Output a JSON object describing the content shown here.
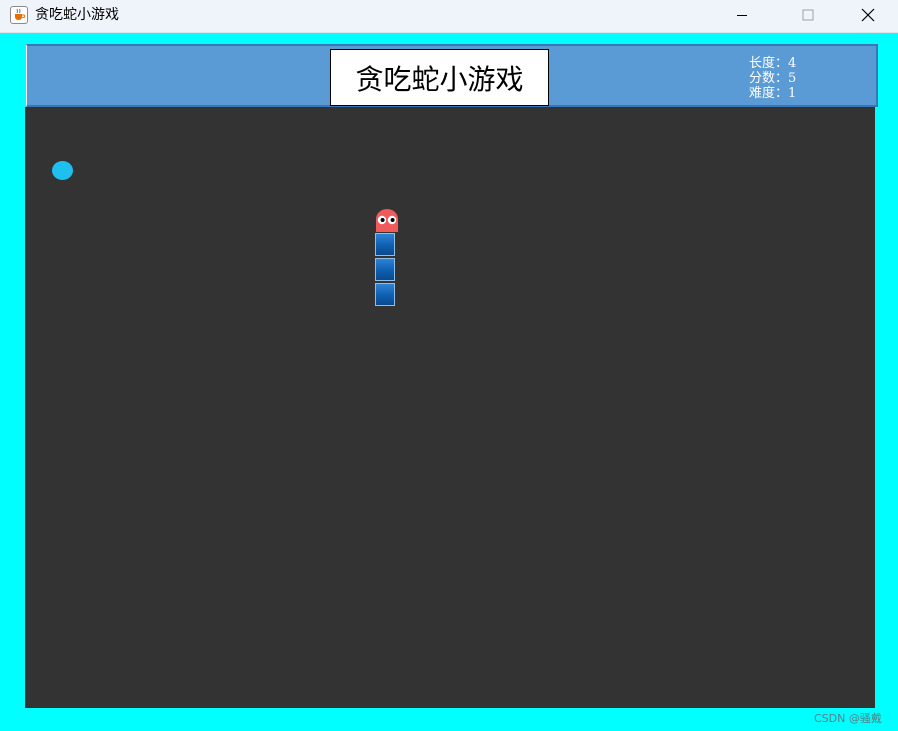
{
  "window": {
    "title": "贪吃蛇小游戏",
    "icon": "java-cup-icon",
    "controls": [
      "minimize-icon",
      "maximize-icon",
      "close-icon"
    ]
  },
  "header": {
    "game_title": "贪吃蛇小游戏",
    "stats": {
      "length_label": "长度：4",
      "score_label": "分数：5",
      "difficulty_label": "难度：1"
    }
  },
  "game": {
    "snake_length": 4,
    "score": 5,
    "difficulty": 1,
    "colors": {
      "background": "#333333",
      "border": "#00ffff",
      "header": "#5b9bd5",
      "food": "#1ec0f0",
      "snake_head": "#f05a5a",
      "snake_body": "#0d5fb0"
    }
  },
  "watermark": "CSDN @骚戴"
}
